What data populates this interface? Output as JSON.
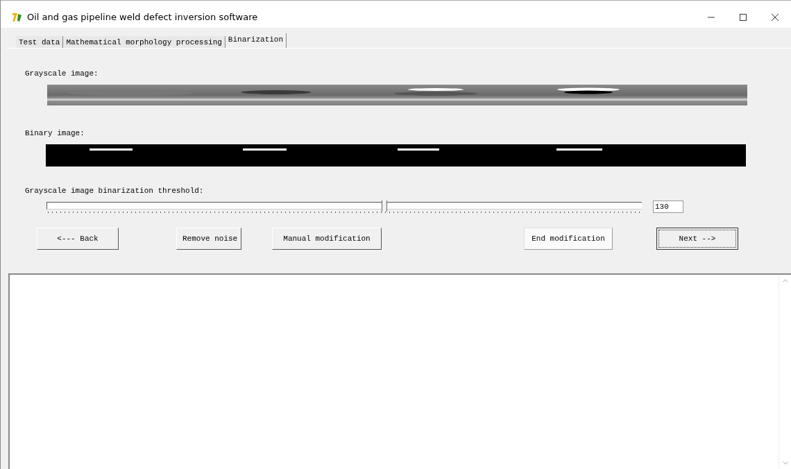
{
  "window": {
    "title": "Oil and gas pipeline weld defect inversion software"
  },
  "tabs": [
    {
      "label": "Test data",
      "selected": false
    },
    {
      "label": "Mathematical morphology processing",
      "selected": false
    },
    {
      "label": "Binarization",
      "selected": true
    }
  ],
  "grayscale": {
    "label": "Grayscale image:"
  },
  "binary": {
    "label": "Binary image:"
  },
  "threshold": {
    "label": "Grayscale image binarization threshold:",
    "level": 0.566,
    "value": "130"
  },
  "buttons": [
    {
      "label": "<--- Back",
      "kind": "normal"
    },
    {
      "label": "Remove noise",
      "kind": "normal"
    },
    {
      "label": "Manual modification",
      "kind": "normal"
    },
    {
      "label": "End modification",
      "kind": "flat"
    },
    {
      "label": "Next -->",
      "kind": "default"
    }
  ]
}
